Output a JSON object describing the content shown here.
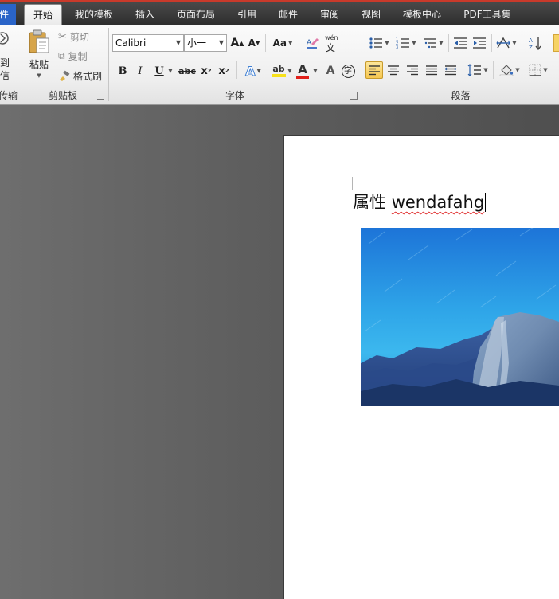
{
  "tabs": [
    {
      "label": "件"
    },
    {
      "label": "开始"
    },
    {
      "label": "我的模板"
    },
    {
      "label": "插入"
    },
    {
      "label": "页面布局"
    },
    {
      "label": "引用"
    },
    {
      "label": "邮件"
    },
    {
      "label": "审阅"
    },
    {
      "label": "视图"
    },
    {
      "label": "模板中心"
    },
    {
      "label": "PDF工具集"
    }
  ],
  "ribbon": {
    "transfer": {
      "line1": "到",
      "line2": "信",
      "group_label": "传输"
    },
    "clipboard": {
      "paste_label": "粘贴",
      "cut_label": "剪切",
      "copy_label": "复制",
      "format_painter_label": "格式刷",
      "group_label": "剪贴板"
    },
    "font": {
      "font_name": "Calibri",
      "font_size": "小一",
      "group_label": "字体",
      "change_case_label": "Aa",
      "grow_label": "A",
      "shrink_label": "A",
      "bold": "B",
      "italic": "I",
      "underline": "U",
      "strikethrough": "abc",
      "subscript": "x",
      "superscript": "x",
      "text_effect": "A",
      "highlight": "ab",
      "font_color": "A",
      "char_shading": "A",
      "enclose": "字",
      "pinyin": "wén"
    },
    "paragraph": {
      "group_label": "段落"
    }
  },
  "document": {
    "text_prefix": "属性 ",
    "text_word": "wendafahg"
  },
  "colors": {
    "accent_file_tab": "#2a64c8",
    "highlight_yellow": "#f7e11a",
    "font_color_red": "#e0201a",
    "spell_error_red": "#e03030"
  }
}
